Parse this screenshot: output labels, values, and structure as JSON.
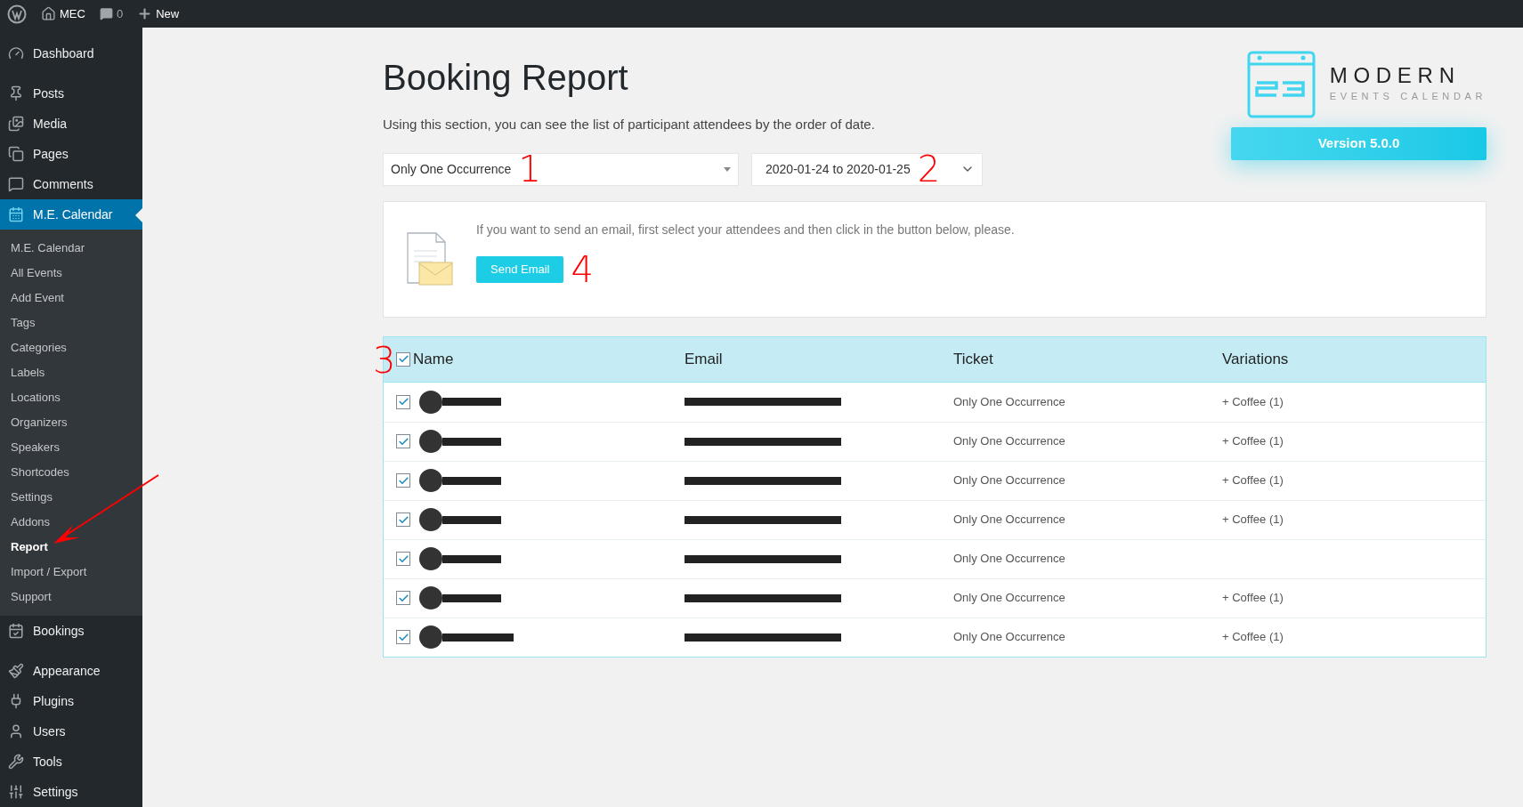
{
  "admin_bar": {
    "site": "MEC",
    "comments": "0",
    "new": "New"
  },
  "sidebar": {
    "items": [
      {
        "label": "Dashboard",
        "selected": false
      },
      {
        "label": "Posts",
        "selected": false
      },
      {
        "label": "Media",
        "selected": false
      },
      {
        "label": "Pages",
        "selected": false
      },
      {
        "label": "Comments",
        "selected": false
      },
      {
        "label": "M.E. Calendar",
        "selected": true,
        "children": [
          {
            "label": "M.E. Calendar",
            "selected": false
          },
          {
            "label": "All Events",
            "selected": false
          },
          {
            "label": "Add Event",
            "selected": false
          },
          {
            "label": "Tags",
            "selected": false
          },
          {
            "label": "Categories",
            "selected": false
          },
          {
            "label": "Labels",
            "selected": false
          },
          {
            "label": "Locations",
            "selected": false
          },
          {
            "label": "Organizers",
            "selected": false
          },
          {
            "label": "Speakers",
            "selected": false
          },
          {
            "label": "Shortcodes",
            "selected": false
          },
          {
            "label": "Settings",
            "selected": false
          },
          {
            "label": "Addons",
            "selected": false
          },
          {
            "label": "Report",
            "selected": true
          },
          {
            "label": "Import / Export",
            "selected": false
          },
          {
            "label": "Support",
            "selected": false
          }
        ]
      },
      {
        "label": "Bookings",
        "selected": false
      },
      {
        "label": "Appearance",
        "selected": false
      },
      {
        "label": "Plugins",
        "selected": false
      },
      {
        "label": "Users",
        "selected": false
      },
      {
        "label": "Tools",
        "selected": false
      },
      {
        "label": "Settings",
        "selected": false
      }
    ]
  },
  "page": {
    "title": "Booking Report",
    "description": "Using this section, you can see the list of participant attendees by the order of date."
  },
  "logo": {
    "name": "MODERN",
    "tagline": "EVENTS CALENDAR",
    "version": "Version 5.0.0"
  },
  "filters": [
    {
      "value": "Only One Occurrence",
      "annotation": "1"
    },
    {
      "value": "2020-01-24 to 2020-01-25",
      "annotation": "2"
    }
  ],
  "email_box": {
    "text": "If you want to send an email, first select your attendees and then click in the button below, please.",
    "button": "Send Email",
    "annotation": "4"
  },
  "table": {
    "select_all": {
      "checked": true,
      "annotation": "3"
    },
    "columns": [
      "Name",
      "Email",
      "Ticket",
      "Variations"
    ],
    "rows": [
      {
        "checked": true,
        "ticket": "Only One Occurrence",
        "variations": "+ Coffee (1)"
      },
      {
        "checked": true,
        "ticket": "Only One Occurrence",
        "variations": "+ Coffee (1)"
      },
      {
        "checked": true,
        "ticket": "Only One Occurrence",
        "variations": "+ Coffee (1)"
      },
      {
        "checked": true,
        "ticket": "Only One Occurrence",
        "variations": "+ Coffee (1)"
      },
      {
        "checked": true,
        "ticket": "Only One Occurrence"
      },
      {
        "checked": true,
        "ticket": "Only One Occurrence",
        "variations": "+ Coffee (1)"
      },
      {
        "checked": true,
        "ticket": "Only One Occurrence",
        "variations": "+ Coffee (1)"
      }
    ]
  }
}
